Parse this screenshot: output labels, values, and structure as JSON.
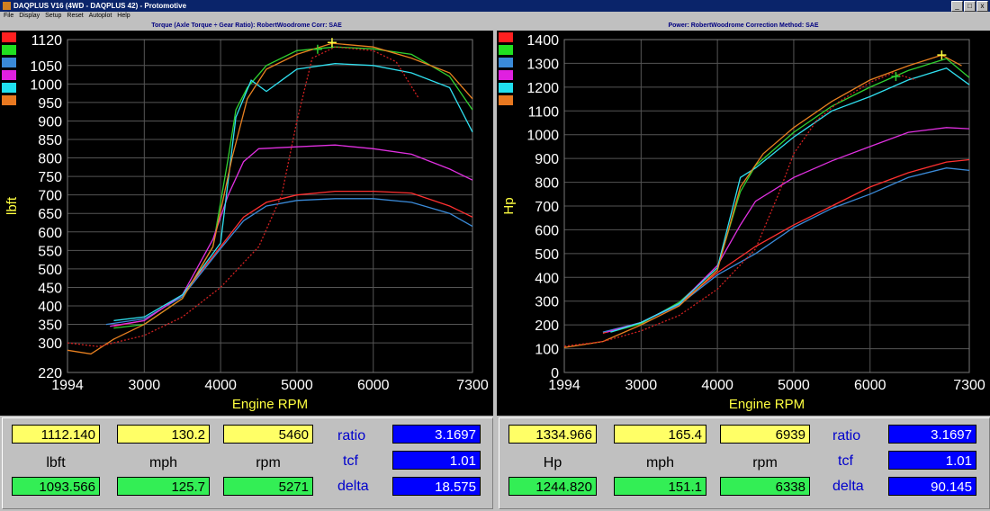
{
  "window": {
    "title": "DAQPLUS V16 (4WD - DAQPLUS 42) - Protomotive",
    "menu": [
      "File",
      "Display",
      "Setup",
      "Reset",
      "Autoplot",
      "Help"
    ],
    "buttons": [
      "_",
      "□",
      "x"
    ]
  },
  "chart_data": [
    {
      "type": "line",
      "title": "Torque (Axle Torque ÷ Gear Ratio): RobertWoodrome      Corr: SAE",
      "xlabel": "Engine RPM",
      "ylabel": "lbft",
      "xlim": [
        1994,
        7300
      ],
      "ylim": [
        220,
        1120
      ],
      "x_ticks": [
        "1994",
        "3000",
        "4000",
        "5000",
        "6000",
        "7300"
      ],
      "y_ticks": [
        220,
        300,
        350,
        400,
        450,
        500,
        550,
        600,
        650,
        700,
        750,
        800,
        850,
        900,
        950,
        1000,
        1050,
        1120
      ],
      "grid": true,
      "legend": "top-left color swatches",
      "series": [
        {
          "color": "#ff3030",
          "dashed": false,
          "x": [
            2600,
            3000,
            3500,
            4000,
            4300,
            4600,
            5000,
            5500,
            6000,
            6500,
            7000,
            7300
          ],
          "y": [
            345,
            360,
            430,
            560,
            640,
            680,
            700,
            710,
            710,
            705,
            670,
            640
          ]
        },
        {
          "color": "#30d030",
          "dashed": false,
          "x": [
            2600,
            3000,
            3500,
            3900,
            4100,
            4200,
            4350,
            4600,
            5000,
            5500,
            6000,
            6500,
            7000,
            7300
          ],
          "y": [
            340,
            350,
            420,
            560,
            800,
            930,
            990,
            1050,
            1090,
            1100,
            1095,
            1080,
            1020,
            930
          ]
        },
        {
          "color": "#3a8ad8",
          "dashed": false,
          "x": [
            2500,
            3000,
            3500,
            4000,
            4300,
            4600,
            5000,
            5500,
            6000,
            6500,
            7000,
            7300
          ],
          "y": [
            350,
            365,
            425,
            555,
            630,
            670,
            685,
            690,
            690,
            680,
            650,
            615
          ]
        },
        {
          "color": "#e030e0",
          "dashed": false,
          "x": [
            2550,
            3000,
            3500,
            3900,
            4100,
            4300,
            4500,
            5000,
            5500,
            6000,
            6500,
            7000,
            7300
          ],
          "y": [
            345,
            360,
            430,
            580,
            700,
            790,
            825,
            830,
            835,
            825,
            810,
            770,
            740
          ]
        },
        {
          "color": "#30e0f0",
          "dashed": false,
          "x": [
            2600,
            3000,
            3500,
            4000,
            4200,
            4400,
            4600,
            4800,
            5000,
            5500,
            6000,
            6500,
            7000,
            7300
          ],
          "y": [
            360,
            370,
            430,
            570,
            910,
            1010,
            980,
            1010,
            1040,
            1055,
            1050,
            1030,
            990,
            870
          ]
        },
        {
          "color": "#e88020",
          "dashed": false,
          "x": [
            1994,
            2300,
            2600,
            3000,
            3500,
            3900,
            4150,
            4350,
            4600,
            5000,
            5460,
            6000,
            6500,
            7000,
            7300
          ],
          "y": [
            280,
            270,
            310,
            350,
            420,
            560,
            800,
            960,
            1040,
            1080,
            1110,
            1100,
            1070,
            1030,
            960
          ]
        },
        {
          "color": "#d02020",
          "dashed": true,
          "x": [
            1994,
            2400,
            3000,
            3500,
            4000,
            4500,
            4800,
            5000,
            5200,
            5500,
            6000,
            6300,
            6600
          ],
          "y": [
            300,
            290,
            320,
            370,
            450,
            560,
            700,
            900,
            1070,
            1100,
            1090,
            1060,
            960
          ]
        }
      ],
      "markers": [
        {
          "x": 5460,
          "y": 1112,
          "color": "#ffff40"
        },
        {
          "x": 5271,
          "y": 1094,
          "color": "#30d030"
        }
      ]
    },
    {
      "type": "line",
      "title": "Power: RobertWoodrome      Correction Method: SAE",
      "xlabel": "Engine RPM",
      "ylabel": "Hp",
      "xlim": [
        1994,
        7300
      ],
      "ylim": [
        0,
        1400
      ],
      "x_ticks": [
        "1994",
        "3000",
        "4000",
        "5000",
        "6000",
        "7300"
      ],
      "y_ticks": [
        0,
        100,
        200,
        300,
        400,
        500,
        600,
        700,
        800,
        900,
        1000,
        1100,
        1200,
        1300,
        1400
      ],
      "grid": true,
      "legend": "top-left color swatches",
      "series": [
        {
          "color": "#ff3030",
          "dashed": false,
          "x": [
            2500,
            3000,
            3500,
            4000,
            4500,
            5000,
            5500,
            6000,
            6500,
            7000,
            7300
          ],
          "y": [
            165,
            210,
            290,
            420,
            530,
            620,
            700,
            780,
            840,
            885,
            895
          ]
        },
        {
          "color": "#30d030",
          "dashed": false,
          "x": [
            2600,
            3000,
            3500,
            4000,
            4300,
            4500,
            5000,
            5500,
            6000,
            6500,
            7000,
            7300
          ],
          "y": [
            170,
            205,
            295,
            440,
            760,
            870,
            1010,
            1120,
            1200,
            1270,
            1320,
            1240
          ]
        },
        {
          "color": "#3a8ad8",
          "dashed": false,
          "x": [
            2500,
            3000,
            3500,
            4000,
            4500,
            5000,
            5500,
            6000,
            6500,
            7000,
            7300
          ],
          "y": [
            170,
            210,
            285,
            410,
            500,
            610,
            690,
            750,
            820,
            860,
            850
          ]
        },
        {
          "color": "#e030e0",
          "dashed": false,
          "x": [
            2550,
            3000,
            3500,
            4000,
            4300,
            4500,
            5000,
            5500,
            6000,
            6500,
            7000,
            7300
          ],
          "y": [
            170,
            210,
            290,
            450,
            620,
            720,
            820,
            890,
            950,
            1010,
            1030,
            1025
          ]
        },
        {
          "color": "#30e0f0",
          "dashed": false,
          "x": [
            2600,
            3000,
            3500,
            4000,
            4300,
            4500,
            5000,
            5500,
            6000,
            6500,
            7000,
            7300
          ],
          "y": [
            170,
            210,
            290,
            440,
            820,
            860,
            990,
            1100,
            1160,
            1230,
            1280,
            1210
          ]
        },
        {
          "color": "#e88020",
          "dashed": false,
          "x": [
            1994,
            2500,
            3000,
            3500,
            4000,
            4300,
            4600,
            5000,
            5500,
            6000,
            6500,
            6939,
            7200
          ],
          "y": [
            105,
            130,
            200,
            280,
            430,
            780,
            920,
            1030,
            1140,
            1230,
            1290,
            1335,
            1290
          ]
        },
        {
          "color": "#d02020",
          "dashed": true,
          "x": [
            1994,
            2500,
            3000,
            3500,
            4000,
            4500,
            4800,
            5000,
            5300,
            5600,
            6000,
            6300,
            6600
          ],
          "y": [
            110,
            130,
            175,
            240,
            350,
            520,
            750,
            920,
            1060,
            1140,
            1220,
            1260,
            1230
          ]
        }
      ],
      "markers": [
        {
          "x": 6939,
          "y": 1335,
          "color": "#ffff40"
        },
        {
          "x": 6338,
          "y": 1245,
          "color": "#30d030"
        }
      ]
    }
  ],
  "readouts": [
    {
      "top": [
        "1112.140",
        "130.2",
        "5460"
      ],
      "units": [
        "lbft",
        "mph",
        "rpm"
      ],
      "bottom": [
        "1093.566",
        "125.7",
        "5271"
      ],
      "params": [
        {
          "label": "ratio",
          "value": "3.1697"
        },
        {
          "label": "tcf",
          "value": "1.01"
        },
        {
          "label": "delta",
          "value": "18.575"
        }
      ]
    },
    {
      "top": [
        "1334.966",
        "165.4",
        "6939"
      ],
      "units": [
        "Hp",
        "mph",
        "rpm"
      ],
      "bottom": [
        "1244.820",
        "151.1",
        "6338"
      ],
      "params": [
        {
          "label": "ratio",
          "value": "3.1697"
        },
        {
          "label": "tcf",
          "value": "1.01"
        },
        {
          "label": "delta",
          "value": "90.145"
        }
      ]
    }
  ],
  "legend_colors": [
    "#ff2020",
    "#20e020",
    "#3a8ad8",
    "#e020e0",
    "#20e0f0",
    "#e87820"
  ]
}
